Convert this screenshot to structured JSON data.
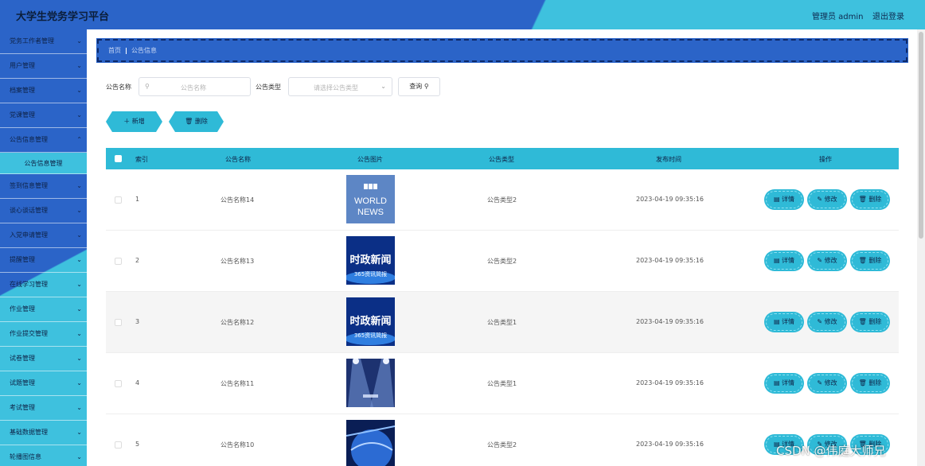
{
  "header": {
    "title": "大学生党务学习平台",
    "user": "管理员 admin",
    "logout": "退出登录"
  },
  "sidebar": {
    "items": [
      {
        "label": "党务工作者管理"
      },
      {
        "label": "用户管理"
      },
      {
        "label": "档案管理"
      },
      {
        "label": "党课管理"
      },
      {
        "label": "公告信息管理"
      },
      {
        "label": "签到信息管理"
      },
      {
        "label": "谈心谈话管理"
      },
      {
        "label": "入党申请管理"
      },
      {
        "label": "提醒管理"
      },
      {
        "label": "在线学习管理"
      },
      {
        "label": "作业管理"
      },
      {
        "label": "作业提交管理"
      },
      {
        "label": "试卷管理"
      },
      {
        "label": "试题管理"
      },
      {
        "label": "考试管理"
      },
      {
        "label": "基础数据管理"
      },
      {
        "label": "轮播图信息"
      }
    ],
    "active_sub": "公告信息管理"
  },
  "breadcrumb": {
    "home": "首页",
    "current": "公告信息"
  },
  "search": {
    "name_label": "公告名称",
    "name_placeholder": "公告名称",
    "type_label": "公告类型",
    "type_placeholder": "请选择公告类型",
    "query_label": "查询"
  },
  "actions": {
    "add": "新增",
    "delete": "删除"
  },
  "table": {
    "headers": [
      "索引",
      "公告名称",
      "公告图片",
      "公告类型",
      "发布时间",
      "操作"
    ],
    "rows": [
      {
        "index": "1",
        "name": "公告名称14",
        "image": "BBC WORLD NEWS",
        "type": "公告类型2",
        "time": "2023-04-19 09:35:16"
      },
      {
        "index": "2",
        "name": "公告名称13",
        "image": "时政新闻 365资讯简报",
        "type": "公告类型2",
        "time": "2023-04-19 09:35:16"
      },
      {
        "index": "3",
        "name": "公告名称12",
        "image": "时政新闻 365资讯简报",
        "type": "公告类型1",
        "time": "2023-04-19 09:35:16"
      },
      {
        "index": "4",
        "name": "公告名称11",
        "image": "stage-light",
        "type": "公告类型1",
        "time": "2023-04-19 09:35:16"
      },
      {
        "index": "5",
        "name": "公告名称10",
        "image": "globe",
        "type": "公告类型2",
        "time": "2023-04-19 09:35:16"
      }
    ],
    "row_actions": {
      "detail": "详情",
      "edit": "修改",
      "delete": "删除"
    }
  },
  "watermark": "CSDN @伟庭大师兄",
  "colors": {
    "primary": "#2b64c8",
    "accent": "#2fbad7"
  }
}
